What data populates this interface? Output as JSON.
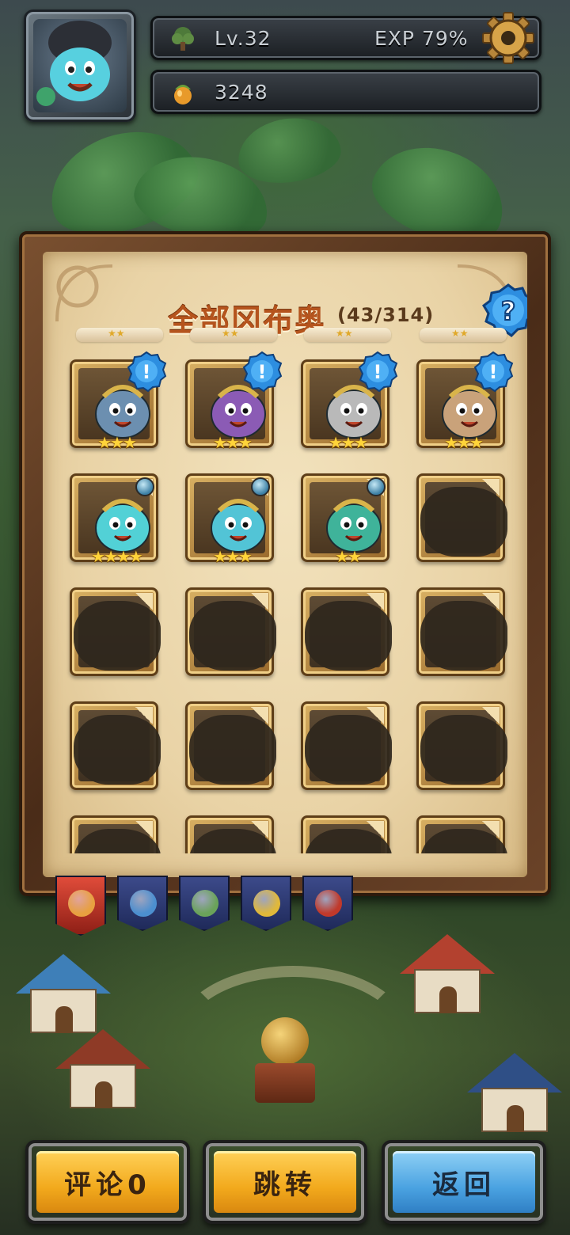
{
  "hud": {
    "level": "Lv.32",
    "exp": "EXP 79%",
    "coins": "3248",
    "settings_icon": "gear-icon"
  },
  "collection": {
    "title": "全部冈布奥",
    "count": "(43/314)",
    "help_icon": "question-icon"
  },
  "cards": [
    {
      "state": "owned",
      "stars": "★★★",
      "badge": "!",
      "color": "#6c8fb0"
    },
    {
      "state": "owned",
      "stars": "★★★",
      "badge": "!",
      "color": "#8b5bb5"
    },
    {
      "state": "owned",
      "stars": "★★★",
      "badge": "!",
      "color": "#b9b9b9"
    },
    {
      "state": "owned",
      "stars": "★★★",
      "badge": "!",
      "color": "#c9a27a"
    },
    {
      "state": "owned",
      "stars": "★★★★",
      "badge": "",
      "color": "#52d1d6"
    },
    {
      "state": "owned",
      "stars": "★★★",
      "badge": "",
      "color": "#52c4d6"
    },
    {
      "state": "owned",
      "stars": "★★",
      "badge": "",
      "color": "#3fb39a"
    },
    {
      "state": "locked",
      "stars": "",
      "badge": "",
      "color": ""
    },
    {
      "state": "locked",
      "stars": "",
      "badge": "",
      "color": ""
    },
    {
      "state": "locked",
      "stars": "",
      "badge": "",
      "color": ""
    },
    {
      "state": "locked",
      "stars": "",
      "badge": "",
      "color": ""
    },
    {
      "state": "locked",
      "stars": "",
      "badge": "",
      "color": ""
    },
    {
      "state": "locked",
      "stars": "",
      "badge": "",
      "color": ""
    },
    {
      "state": "locked",
      "stars": "",
      "badge": "",
      "color": ""
    },
    {
      "state": "locked",
      "stars": "",
      "badge": "",
      "color": ""
    },
    {
      "state": "locked",
      "stars": "",
      "badge": "",
      "color": ""
    },
    {
      "state": "locked",
      "stars": "",
      "badge": "",
      "color": ""
    },
    {
      "state": "locked",
      "stars": "",
      "badge": "",
      "color": ""
    },
    {
      "state": "locked",
      "stars": "",
      "badge": "",
      "color": ""
    },
    {
      "state": "locked",
      "stars": "",
      "badge": "",
      "color": ""
    }
  ],
  "tabs": [
    {
      "name": "all-tab",
      "active": true,
      "color": "#e8a040"
    },
    {
      "name": "blue-tab",
      "active": false,
      "color": "#4c8fd0"
    },
    {
      "name": "green-tab",
      "active": false,
      "color": "#6aa35a"
    },
    {
      "name": "yellow-tab",
      "active": false,
      "color": "#e0b83a"
    },
    {
      "name": "red-tab",
      "active": false,
      "color": "#c0392b"
    }
  ],
  "buttons": {
    "comment": "评论0",
    "jump": "跳转",
    "back": "返回"
  },
  "colors": {
    "accent_title": "#b5541d",
    "button_yellow": "#f2a91c",
    "button_blue": "#4aa2e1",
    "star": "#ffd43a",
    "badge_blue": "#2d8ee0"
  }
}
